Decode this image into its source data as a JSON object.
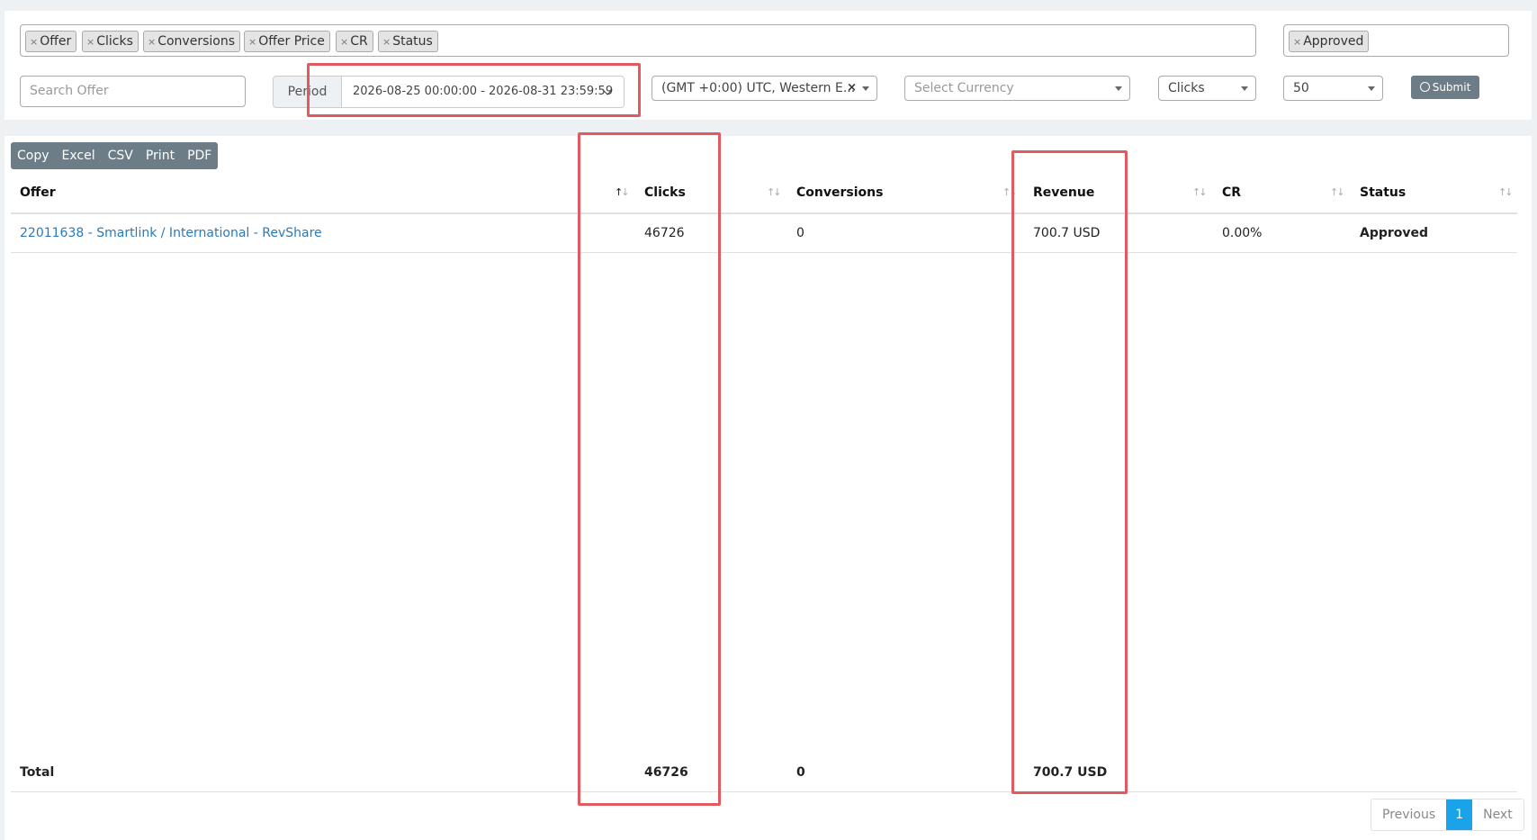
{
  "columns_tags": [
    "Offer",
    "Clicks",
    "Conversions",
    "Offer Price",
    "CR",
    "Status"
  ],
  "status_tag": "Approved",
  "tag_remove_glyph": "×",
  "search": {
    "placeholder": "Search Offer"
  },
  "period": {
    "label": "Period",
    "value": "2026-08-25 00:00:00 - 2026-08-31 23:59:59"
  },
  "timezone": {
    "value": "(GMT +0:00) UTC, Western E..."
  },
  "currency": {
    "placeholder": "Select Currency"
  },
  "sort_by": {
    "value": "Clicks"
  },
  "page_size": {
    "value": "50"
  },
  "submit_label": "Submit",
  "export_buttons": [
    "Copy",
    "Excel",
    "CSV",
    "Print",
    "PDF"
  ],
  "table": {
    "headers": [
      "Offer",
      "Clicks",
      "Conversions",
      "Revenue",
      "CR",
      "Status"
    ],
    "rows": [
      {
        "offer": "22011638 - Smartlink / International - RevShare",
        "clicks": "46726",
        "conversions": "0",
        "revenue": "700.7 USD",
        "cr": "0.00%",
        "status": "Approved"
      }
    ],
    "total": {
      "label": "Total",
      "clicks": "46726",
      "conversions": "0",
      "revenue": "700.7 USD"
    }
  },
  "pagination": {
    "previous": "Previous",
    "current": "1",
    "next": "Next"
  },
  "colors": {
    "accent": "#1aa3e8",
    "link": "#2a7ab8",
    "highlight": "#e05a5f",
    "button": "#6c7d88"
  }
}
